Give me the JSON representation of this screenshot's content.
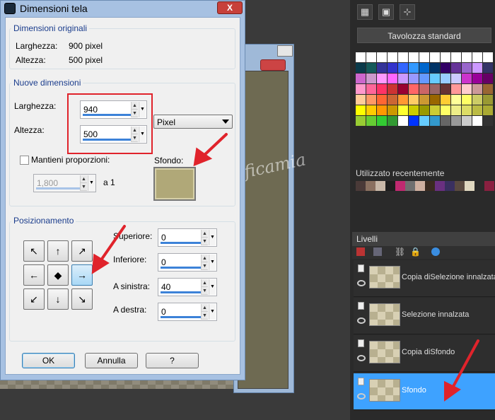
{
  "dialog": {
    "title": "Dimensioni tela",
    "close_label": "X",
    "original": {
      "legend": "Dimensioni originali",
      "width_label": "Larghezza:",
      "width_value": "900 pixel",
      "height_label": "Altezza:",
      "height_value": "500 pixel"
    },
    "new": {
      "legend": "Nuove dimensioni",
      "width_label": "Larghezza:",
      "width_value": "940",
      "height_label": "Altezza:",
      "height_value": "500",
      "unit": "Pixel",
      "keep_ratio_label": "Mantieni proporzioni:",
      "ratio_value": "1,800",
      "ratio_suffix": "a 1",
      "background_label": "Sfondo:",
      "background_color": "#b0a878"
    },
    "positioning": {
      "legend": "Posizionamento",
      "grid": [
        "↖",
        "↑",
        "↗",
        "←",
        "◆",
        "→",
        "↙",
        "↓",
        "↘"
      ],
      "active_index": 5,
      "top_label": "Superiore:",
      "top_value": "0",
      "bottom_label": "Inferiore:",
      "bottom_value": "0",
      "left_label": "A sinistra:",
      "left_value": "40",
      "right_label": "A destra:",
      "right_value": "0"
    },
    "buttons": {
      "ok": "OK",
      "cancel": "Annulla",
      "help": "?"
    }
  },
  "palette": {
    "title": "Tavolozza standard",
    "recent_title": "Utilizzato recentemente",
    "tools": [
      "▦",
      "▣",
      "⊹"
    ]
  },
  "layers": {
    "title": "Livelli",
    "items": [
      {
        "name": "Copia diSelezione innalzata",
        "selected": false
      },
      {
        "name": "Selezione innalzata",
        "selected": false
      },
      {
        "name": "Copia diSfondo",
        "selected": false
      },
      {
        "name": "Sfondo",
        "selected": true
      }
    ]
  },
  "watermark": "Graficamia",
  "colors": {
    "accent_red": "#e0232b",
    "selection_blue": "#3ea2ff"
  }
}
